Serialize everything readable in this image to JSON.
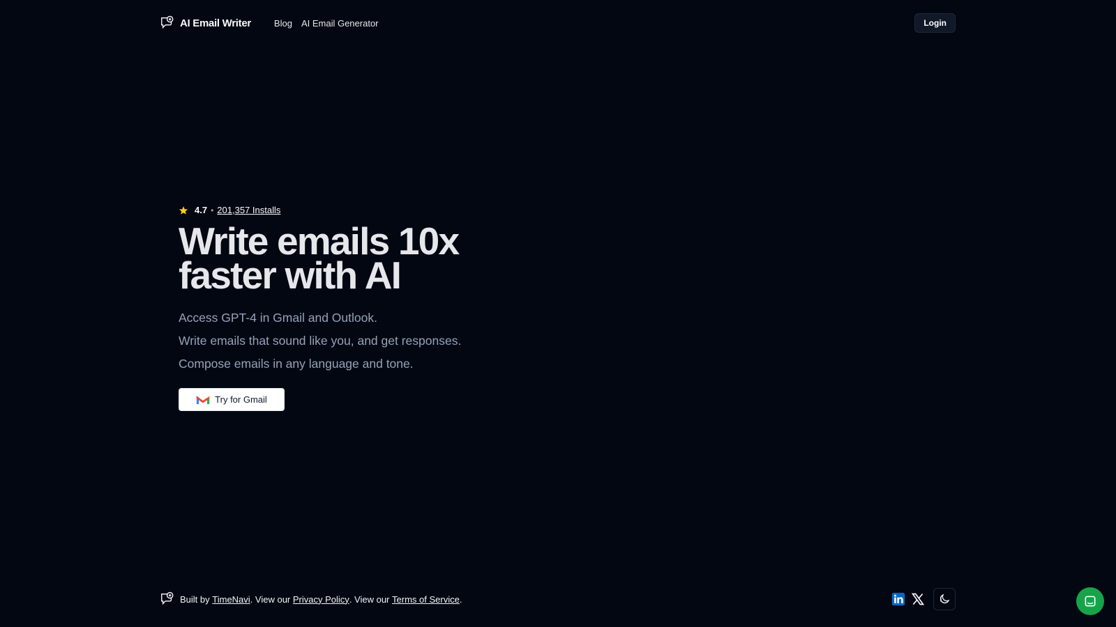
{
  "header": {
    "brand": "AI Email Writer",
    "nav": [
      "Blog",
      "AI Email Generator"
    ],
    "login_label": "Login"
  },
  "hero": {
    "rating": "4.7",
    "separator": "•",
    "installs": "201,357 Installs",
    "headline": "Write emails 10x faster with AI",
    "lines": [
      "Access GPT-4 in Gmail and Outlook.",
      "Write emails that sound like you, and get responses.",
      "Compose emails in any language and tone."
    ],
    "cta_label": "Try for Gmail"
  },
  "footer": {
    "built_by": "Built by",
    "builder": "TimeNavi",
    "view_our_1": ". View our",
    "privacy": "Privacy Policy",
    "view_our_2": ". View our",
    "terms": "Terms of Service",
    "end": "."
  },
  "icons": {
    "logo": "chat-bubble-logo-icon",
    "star": "star-icon",
    "gmail": "gmail-icon",
    "linkedin": "linkedin-icon",
    "x": "x-icon",
    "theme": "theme-toggle-icon",
    "chat": "chat-icon"
  },
  "colors": {
    "background": "#030712",
    "star": "#facc15",
    "linkedin": "#0a66c2",
    "chat": "#16a34a"
  }
}
